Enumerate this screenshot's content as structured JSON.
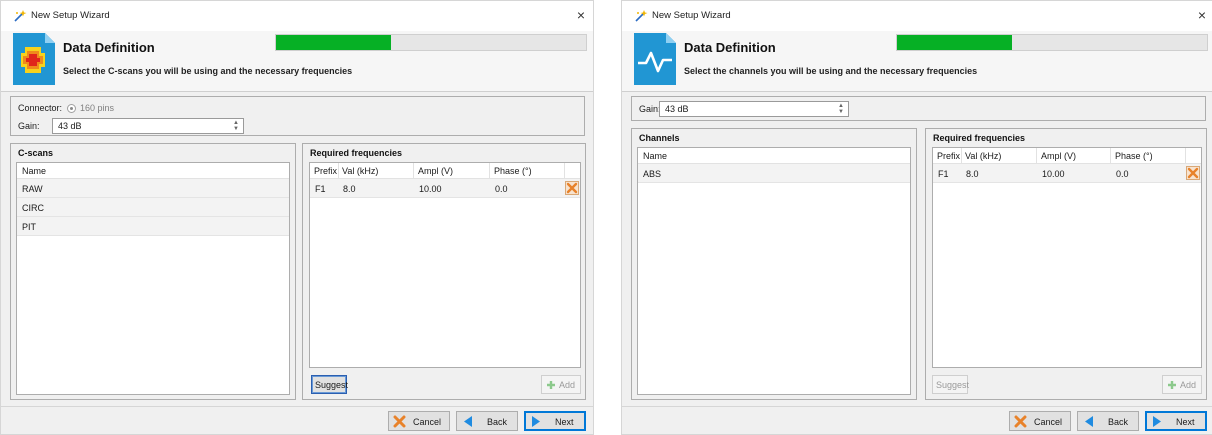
{
  "colors": {
    "progress": "#06b025",
    "accent": "#2196d3",
    "cancel": "#e8822a",
    "nav_arrow": "#1f8be0"
  },
  "windows": [
    {
      "title": "New Setup Wizard",
      "close": "×",
      "header": {
        "title": "Data Definition",
        "subtitle": "Select the C-scans you will be using and the necessary frequencies",
        "progress_fraction": 0.37,
        "logo_icon": "cscan-heatmap-icon"
      },
      "settings": {
        "connector_label": "Connector:",
        "connector_value": "160 pins",
        "gain_label": "Gain:",
        "gain_value": "43 dB"
      },
      "left_panel": {
        "title": "C-scans",
        "column": "Name",
        "rows": [
          "RAW",
          "CIRC",
          "PIT"
        ]
      },
      "freq_panel": {
        "title": "Required frequencies",
        "columns": [
          "Prefix",
          "Val (kHz)",
          "Ampl (V)",
          "Phase (°)"
        ],
        "rows": [
          [
            "F1",
            "8.0",
            "10.00",
            "0.0"
          ]
        ],
        "suggest": "Suggest",
        "add": "Add"
      },
      "footer": {
        "cancel": "Cancel",
        "back": "Back",
        "next": "Next"
      }
    },
    {
      "title": "New Setup Wizard",
      "close": "×",
      "header": {
        "title": "Data Definition",
        "subtitle": "Select the channels you will be using and the necessary frequencies",
        "progress_fraction": 0.37,
        "logo_icon": "signal-document-icon"
      },
      "settings": {
        "gain_label": "Gain:",
        "gain_value": "43 dB"
      },
      "left_panel": {
        "title": "Channels",
        "column": "Name",
        "rows": [
          "ABS"
        ]
      },
      "freq_panel": {
        "title": "Required frequencies",
        "columns": [
          "Prefix",
          "Val (kHz)",
          "Ampl (V)",
          "Phase (°)"
        ],
        "rows": [
          [
            "F1",
            "8.0",
            "10.00",
            "0.0"
          ]
        ],
        "suggest": "Suggest",
        "add": "Add"
      },
      "footer": {
        "cancel": "Cancel",
        "back": "Back",
        "next": "Next"
      }
    }
  ]
}
